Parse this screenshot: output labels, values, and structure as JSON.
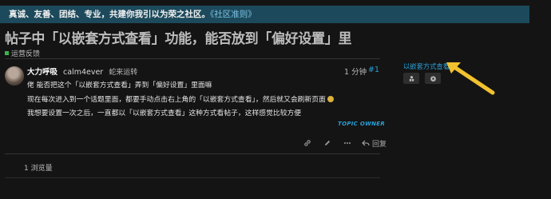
{
  "banner": {
    "text": "真诚、友善、团结、专业，共建你我引以为荣之社区。",
    "link": "《社区准则》"
  },
  "topic": {
    "title": "帖子中「以嵌套方式查看」功能，能否放到「偏好设置」里",
    "category": "运营反馈"
  },
  "post": {
    "display_name": "大力呼吸",
    "username": "calm4ever",
    "user_title": "蛇来运转",
    "time": "1 分钟",
    "number": "#1",
    "lines": [
      "佬 能否把这个「以嵌套方式查看」弄到「偏好设置」里面嘛",
      "现在每次进入到一个话题里面，都要手动点击右上角的「以嵌套方式查看」，然后就又会刷新页面",
      "我想要设置一次之后，一直都以「以嵌套方式查看」这种方式看帖子，这样感觉比较方便"
    ],
    "owner_badge": "TOPIC OWNER",
    "reply_label": "回复",
    "action_icons": [
      "link-icon",
      "pencil-icon",
      "ellipsis-icon",
      "reply-icon"
    ]
  },
  "footer": {
    "views": "1 浏览量"
  },
  "sidebar": {
    "nested_link": "以嵌套方式查看",
    "buttons": [
      "user-card-icon",
      "gear-icon"
    ]
  },
  "colors": {
    "accent": "#2a9fd6",
    "arrow": "#f2c12e",
    "banner": "#1c4a5c"
  }
}
